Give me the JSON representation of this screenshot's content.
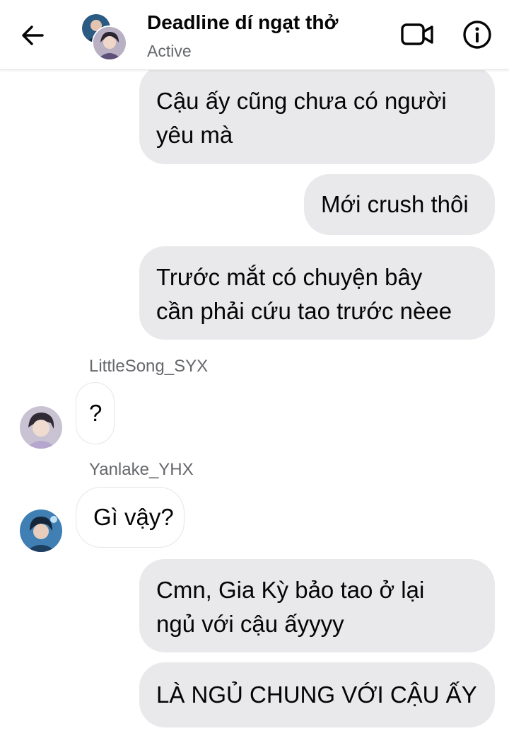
{
  "header": {
    "title": "Deadline dí ngạt thở",
    "status": "Active",
    "back_icon": "arrow-left-icon",
    "video_icon": "video-call-icon",
    "info_icon": "info-icon"
  },
  "messages": [
    {
      "type": "sent",
      "lines": [
        "Cậu ấy cũng chưa có người",
        "yêu mà"
      ]
    },
    {
      "type": "sent",
      "lines": [
        "Mới crush thôi"
      ]
    },
    {
      "type": "sent",
      "lines": [
        "Trước mắt có chuyện bây",
        "cần phải cứu tao trước nèee"
      ]
    },
    {
      "type": "received",
      "sender": "LittleSong_SYX",
      "lines": [
        "?"
      ]
    },
    {
      "type": "received",
      "sender": "Yanlake_YHX",
      "lines": [
        "Gì vậy?"
      ]
    },
    {
      "type": "sent",
      "lines": [
        "Cmn, Gia Kỳ bảo tao ở lại",
        "ngủ với cậu ấyyyy"
      ]
    },
    {
      "type": "sent",
      "lines": [
        "LÀ NGỦ CHUNG VỚI CẬU ẤY"
      ]
    }
  ],
  "colors": {
    "sent_bubble": "#e9e9eb",
    "received_bubble": "#ffffff",
    "secondary_text": "#65676b"
  }
}
